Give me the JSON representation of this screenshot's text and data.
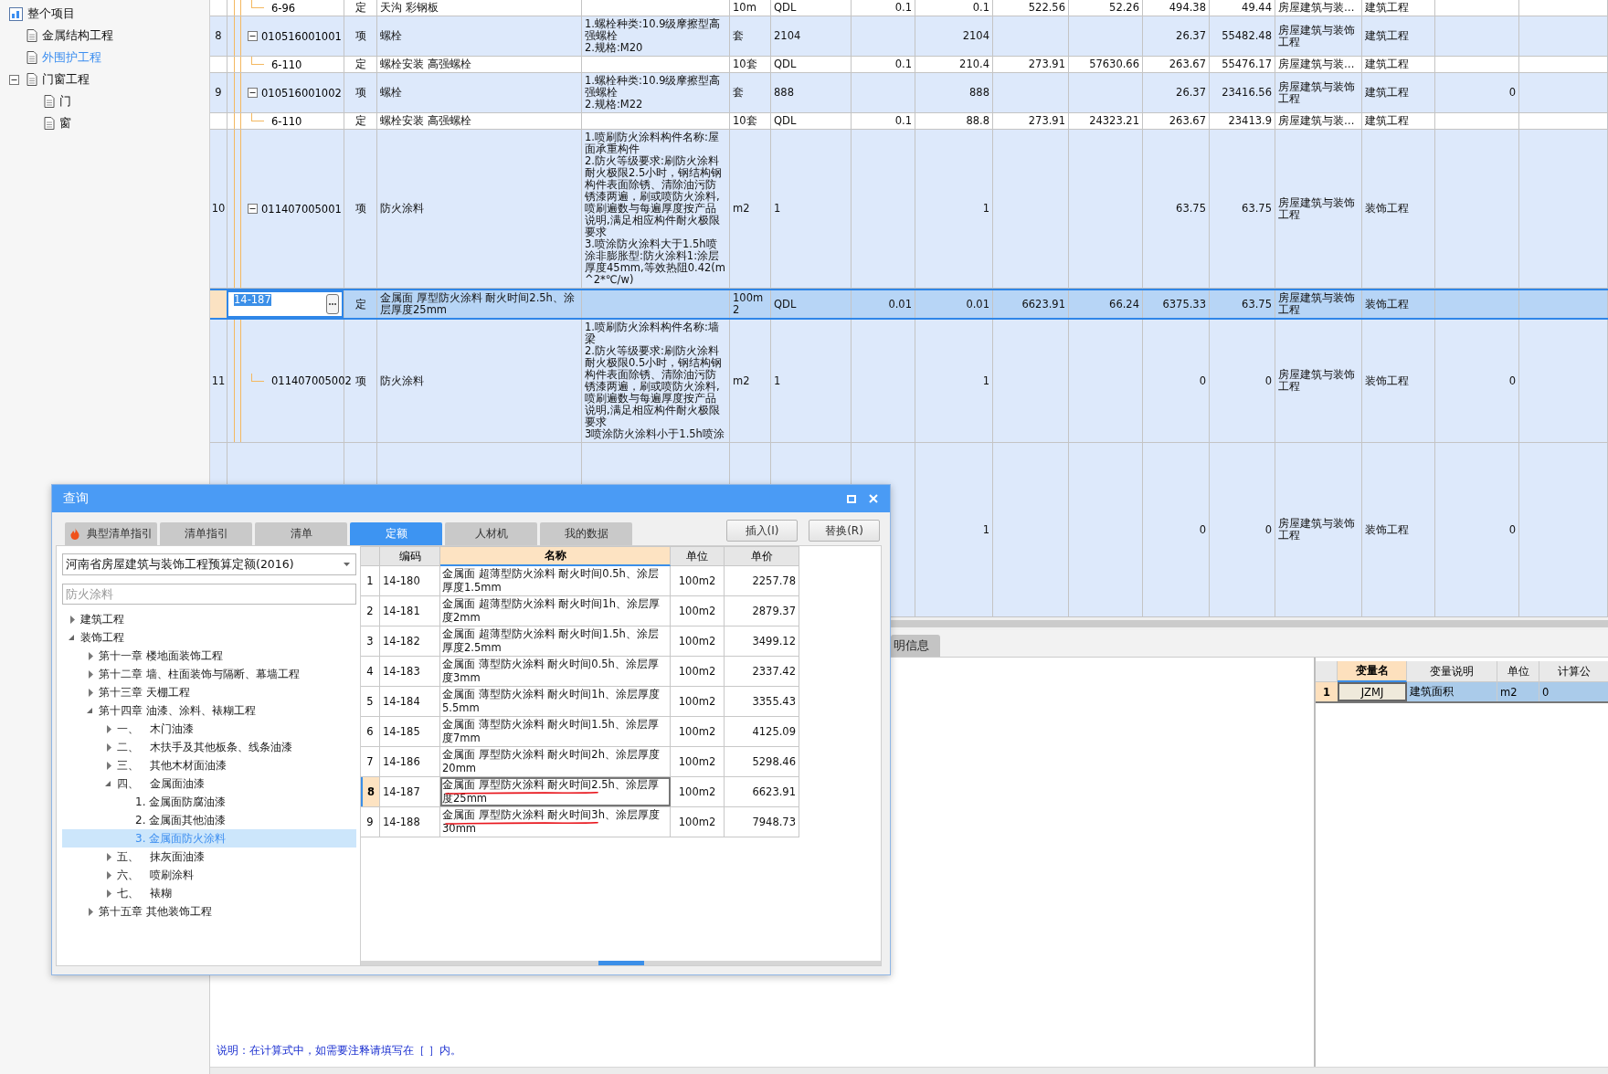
{
  "sidebar": {
    "tree": [
      {
        "label": "整个项目",
        "kind": "project",
        "selected": false,
        "children": [
          {
            "label": "金属结构工程",
            "kind": "document",
            "selected": false
          },
          {
            "label": "外围护工程",
            "kind": "document",
            "selected": true
          },
          {
            "label": "门窗工程",
            "kind": "document",
            "selected": false,
            "expanded": true,
            "children": [
              {
                "label": "门",
                "kind": "document",
                "selected": false
              },
              {
                "label": "窗",
                "kind": "document",
                "selected": false
              }
            ]
          }
        ]
      }
    ]
  },
  "table": {
    "rows": [
      {
        "kind": "quota",
        "code": "6-96",
        "type": "定",
        "name": "天沟 彩钢板",
        "cells": [
          "10m",
          "QDL",
          "0.1",
          "0.1",
          "522.56",
          "52.26",
          "494.38",
          "49.44",
          "房屋建筑与装…",
          "建筑工程",
          null,
          null
        ],
        "selected": false
      },
      {
        "kind": "item",
        "num": "8",
        "code": "010516001001",
        "expanded": true,
        "type": "项",
        "name": "螺栓",
        "desc": "1.螺栓种类:10.9级摩擦型高强螺栓\n2.规格:M20",
        "cells": [
          "套",
          "2104",
          null,
          "2104",
          null,
          null,
          "26.37",
          "55482.48",
          "房屋建筑与装饰工程",
          "建筑工程",
          null,
          null
        ],
        "selected": false
      },
      {
        "kind": "quota",
        "code": "6-110",
        "type": "定",
        "name": "螺栓安装 高强螺栓",
        "cells": [
          "10套",
          "QDL",
          "0.1",
          "210.4",
          "273.91",
          "57630.66",
          "263.67",
          "55476.17",
          "房屋建筑与装…",
          "建筑工程",
          null,
          null
        ],
        "selected": false
      },
      {
        "kind": "item",
        "num": "9",
        "code": "010516001002",
        "expanded": true,
        "type": "项",
        "name": "螺栓",
        "desc": "1.螺栓种类:10.9级摩擦型高强螺栓\n2.规格:M22",
        "cells": [
          "套",
          "888",
          null,
          "888",
          null,
          null,
          "26.37",
          "23416.56",
          "房屋建筑与装饰工程",
          "建筑工程",
          "0",
          null
        ],
        "selected": false
      },
      {
        "kind": "quota",
        "code": "6-110",
        "type": "定",
        "name": "螺栓安装 高强螺栓",
        "cells": [
          "10套",
          "QDL",
          "0.1",
          "88.8",
          "273.91",
          "24323.21",
          "263.67",
          "23413.9",
          "房屋建筑与装…",
          "建筑工程",
          null,
          null
        ],
        "selected": false
      },
      {
        "kind": "item",
        "num": "10",
        "code": "011407005001",
        "expanded": true,
        "type": "项",
        "name": "防火涂料",
        "desc": "1.喷刷防火涂料构件名称:屋面承重构件\n2.防火等级要求:刷防火涂料耐火极限2.5小时，钢结构钢构件表面除锈、清除油污防锈漆两遍，刷或喷防火涂料,喷刷遍数与每遍厚度按产品说明,满足相应构件耐火极限要求\n3.喷涂防火涂料大于1.5h喷涂非膨胀型:防火涂料1:涂层厚度45mm,等效热阻0.42(m^2*℃/w)",
        "cells": [
          "m2",
          "1",
          null,
          "1",
          null,
          null,
          "63.75",
          "63.75",
          "房屋建筑与装饰工程",
          "装饰工程",
          null,
          null
        ],
        "selected": false
      },
      {
        "kind": "quota",
        "code": "14-187",
        "type": "定",
        "name": "金属面 厚型防火涂料 耐火时间2.5h、涂层厚度25mm",
        "cells": [
          "100m2",
          "QDL",
          "0.01",
          "0.01",
          "6623.91",
          "66.24",
          "6375.33",
          "63.75",
          "房屋建筑与装饰工程",
          "装饰工程",
          null,
          null
        ],
        "selected": true
      },
      {
        "kind": "item",
        "num": "11",
        "code": "011407005002",
        "type": "项",
        "name": "防火涂料",
        "desc": "1.喷刷防火涂料构件名称:墙梁\n2.防火等级要求:刷防火涂料耐火极限0.5小时，钢结构钢构件表面除锈、清除油污防锈漆两遍，刷或喷防火涂料,喷刷遍数与每遍厚度按产品说明,满足相应构件耐火极限要求\n3喷涂防火涂料小于1.5h喷涂",
        "cells": [
          "m2",
          "1",
          null,
          "1",
          null,
          null,
          "0",
          "0",
          "房屋建筑与装饰工程",
          "装饰工程",
          "0",
          null
        ],
        "selected": false
      },
      {
        "kind": "item",
        "cells": [
          null,
          null,
          null,
          "1",
          null,
          null,
          "0",
          "0",
          "房屋建筑与装饰工程",
          "装饰工程",
          "0",
          null
        ],
        "selected": false
      }
    ]
  },
  "bottom_panel": {
    "tabs": [
      {
        "label": "明信息",
        "selected": true
      }
    ],
    "variables": {
      "columns": [
        {
          "label": "变量名",
          "selected": true
        },
        {
          "label": "变量说明",
          "selected": false
        },
        {
          "label": "单位",
          "selected": false
        },
        {
          "label": "计算公",
          "selected": false
        }
      ],
      "rows": [
        {
          "num": "1",
          "cells": [
            "JZMJ",
            "建筑面积",
            "m2",
            "0"
          ],
          "selected": true
        }
      ]
    },
    "note": "说明：在计算式中，如需要注释请填写在［ ］内。"
  },
  "dialog": {
    "title": "查询",
    "tabs": [
      {
        "label": "典型清单指引",
        "kind": "hot",
        "selected": false
      },
      {
        "label": "清单指引",
        "kind": "plain",
        "selected": false
      },
      {
        "label": "清单",
        "kind": "plain",
        "selected": false
      },
      {
        "label": "定额",
        "kind": "plain",
        "selected": true
      },
      {
        "label": "人材机",
        "kind": "plain",
        "selected": false
      },
      {
        "label": "我的数据",
        "kind": "plain",
        "selected": false
      }
    ],
    "buttons": [
      "插入(I)",
      "替换(R)"
    ],
    "library": "河南省房屋建筑与装饰工程预算定额(2016)",
    "search": {
      "placeholder": "防火涂料"
    },
    "tree": [
      {
        "label": "建筑工程",
        "expanded": false,
        "selected": false
      },
      {
        "label": "装饰工程",
        "expanded": true,
        "selected": false,
        "children": [
          {
            "label": "第十一章 楼地面装饰工程",
            "expanded": false,
            "selected": false
          },
          {
            "label": "第十二章 墙、柱面装饰与隔断、幕墙工程",
            "expanded": false,
            "selected": false
          },
          {
            "label": "第十三章 天棚工程",
            "expanded": false,
            "selected": false
          },
          {
            "label": "第十四章 油漆、涂料、裱糊工程",
            "expanded": true,
            "selected": false,
            "children": [
              {
                "label": "一、　木门油漆",
                "expanded": false,
                "selected": false
              },
              {
                "label": "二、　木扶手及其他板条、线条油漆",
                "expanded": false,
                "selected": false
              },
              {
                "label": "三、　其他木材面油漆",
                "expanded": false,
                "selected": false
              },
              {
                "label": "四、　金属面油漆",
                "expanded": true,
                "selected": false,
                "children": [
                  {
                    "label": "1. 金属面防腐油漆",
                    "selected": false
                  },
                  {
                    "label": "2. 金属面其他油漆",
                    "selected": false
                  },
                  {
                    "label": "3. 金属面防火涂料",
                    "selected": true
                  }
                ]
              },
              {
                "label": "五、　抹灰面油漆",
                "expanded": false,
                "selected": false
              },
              {
                "label": "六、　喷刷涂料",
                "expanded": false,
                "selected": false
              },
              {
                "label": "七、　裱糊",
                "expanded": false,
                "selected": false
              }
            ]
          },
          {
            "label": "第十五章 其他装饰工程",
            "expanded": false,
            "selected": false
          }
        ]
      }
    ],
    "grid": {
      "columns": [
        {
          "label": "编码",
          "selected": false
        },
        {
          "label": "名称",
          "selected": true
        },
        {
          "label": "单位",
          "selected": false
        },
        {
          "label": "单价",
          "selected": false
        }
      ],
      "rows": [
        {
          "num": "1",
          "code": "14-180",
          "name": "金属面 超薄型防火涂料 耐火时间0.5h、涂层厚度1.5mm",
          "unit": "100m2",
          "price": "2257.78",
          "selected": false
        },
        {
          "num": "2",
          "code": "14-181",
          "name": "金属面 超薄型防火涂料 耐火时间1h、涂层厚度2mm",
          "unit": "100m2",
          "price": "2879.37",
          "selected": false
        },
        {
          "num": "3",
          "code": "14-182",
          "name": "金属面 超薄型防火涂料 耐火时间1.5h、涂层厚度2.5mm",
          "unit": "100m2",
          "price": "3499.12",
          "selected": false
        },
        {
          "num": "4",
          "code": "14-183",
          "name": "金属面 薄型防火涂料 耐火时间0.5h、涂层厚度3mm",
          "unit": "100m2",
          "price": "2337.42",
          "selected": false
        },
        {
          "num": "5",
          "code": "14-184",
          "name": "金属面 薄型防火涂料 耐火时间1h、涂层厚度5.5mm",
          "unit": "100m2",
          "price": "3355.43",
          "selected": false
        },
        {
          "num": "6",
          "code": "14-185",
          "name": "金属面 薄型防火涂料 耐火时间1.5h、涂层厚度7mm",
          "unit": "100m2",
          "price": "4125.09",
          "selected": false
        },
        {
          "num": "7",
          "code": "14-186",
          "name": "金属面 厚型防火涂料 耐火时间2h、涂层厚度20mm",
          "unit": "100m2",
          "price": "5298.46",
          "selected": false
        },
        {
          "num": "8",
          "code": "14-187",
          "name": "金属面 厚型防火涂料 耐火时间2.5h、涂层厚度25mm",
          "unit": "100m2",
          "price": "6623.91",
          "selected": true,
          "underlined": true
        },
        {
          "num": "9",
          "code": "14-188",
          "name": "金属面 厚型防火涂料 耐火时间3h、涂层厚度30mm",
          "unit": "100m2",
          "price": "7948.73",
          "selected": false,
          "underlined": true
        }
      ]
    }
  }
}
